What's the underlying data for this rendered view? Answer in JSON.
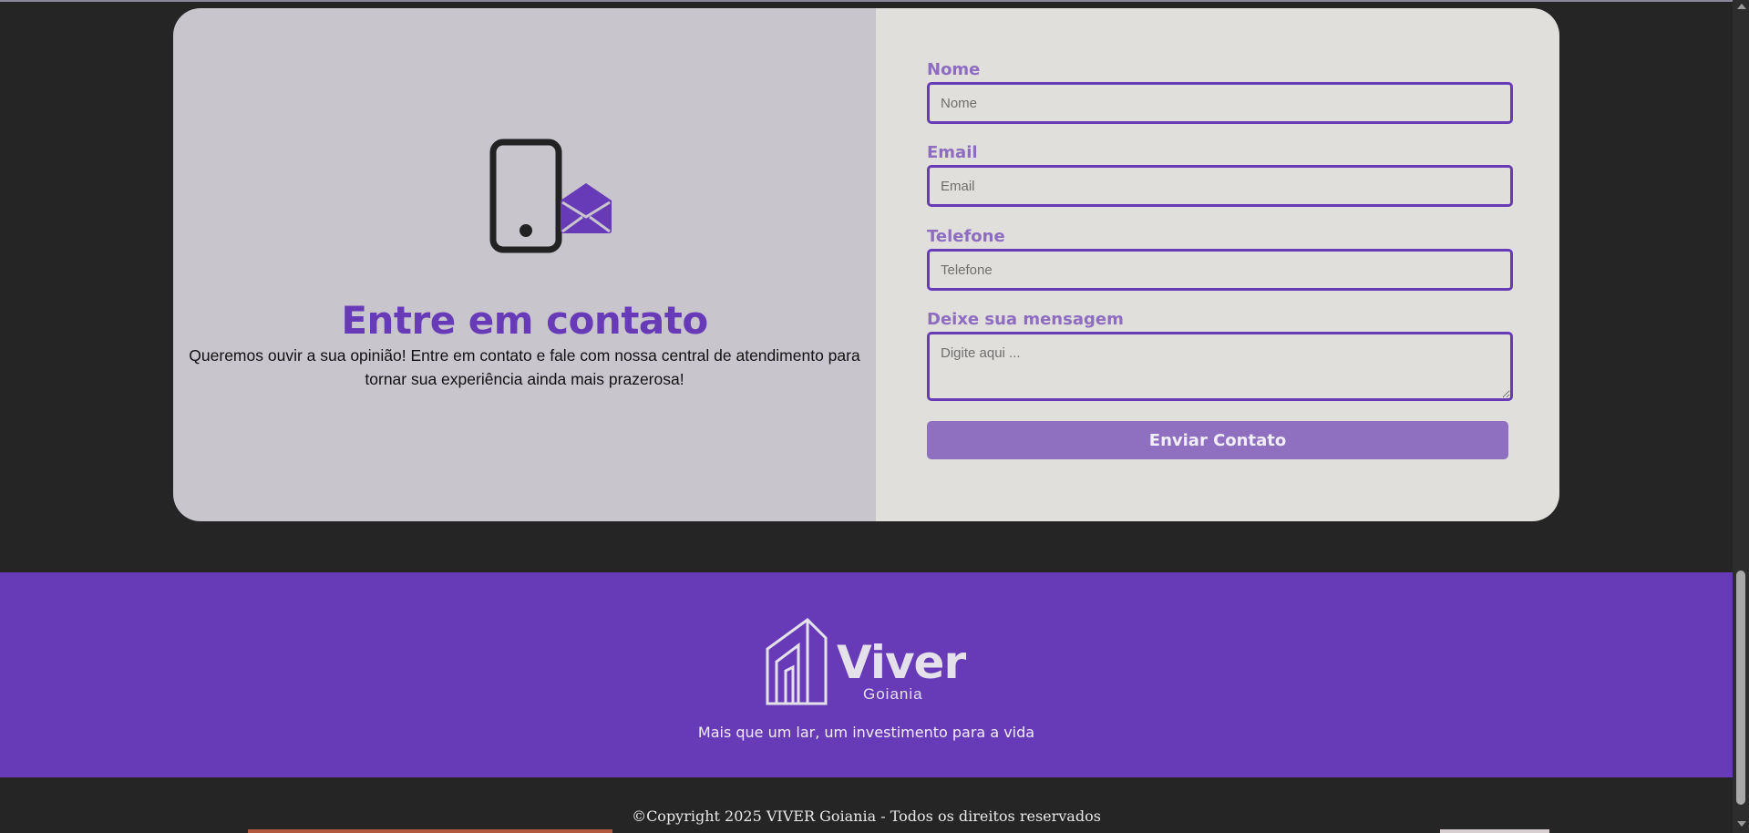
{
  "contact": {
    "title": "Entre em contato",
    "description": "Queremos ouvir a sua opinião! Entre em contato e fale com nossa central de atendimento para tornar sua experiência ainda mais prazerosa!",
    "icons": [
      "phone-icon",
      "envelope-open-icon"
    ]
  },
  "form": {
    "name_label": "Nome",
    "name_placeholder": "Nome",
    "email_label": "Email",
    "email_placeholder": "Email",
    "phone_label": "Telefone",
    "phone_placeholder": "Telefone",
    "message_label": "Deixe sua mensagem",
    "message_placeholder": "Digite aqui ...",
    "submit_label": "Enviar Contato"
  },
  "footer": {
    "brand_name": "Viver",
    "brand_sub": "Goiania",
    "tagline": "Mais que um lar, um investimento para a vida",
    "copyright": "©Copyright 2025 VIVER Goiania - Todos os direitos reservados"
  },
  "colors": {
    "accent": "#673ab7",
    "label": "#8e6cc0",
    "button": "#8e6fc0",
    "page_bg": "#252525",
    "card_left": "#c9c5cd",
    "card_right": "#e0dfdc"
  }
}
